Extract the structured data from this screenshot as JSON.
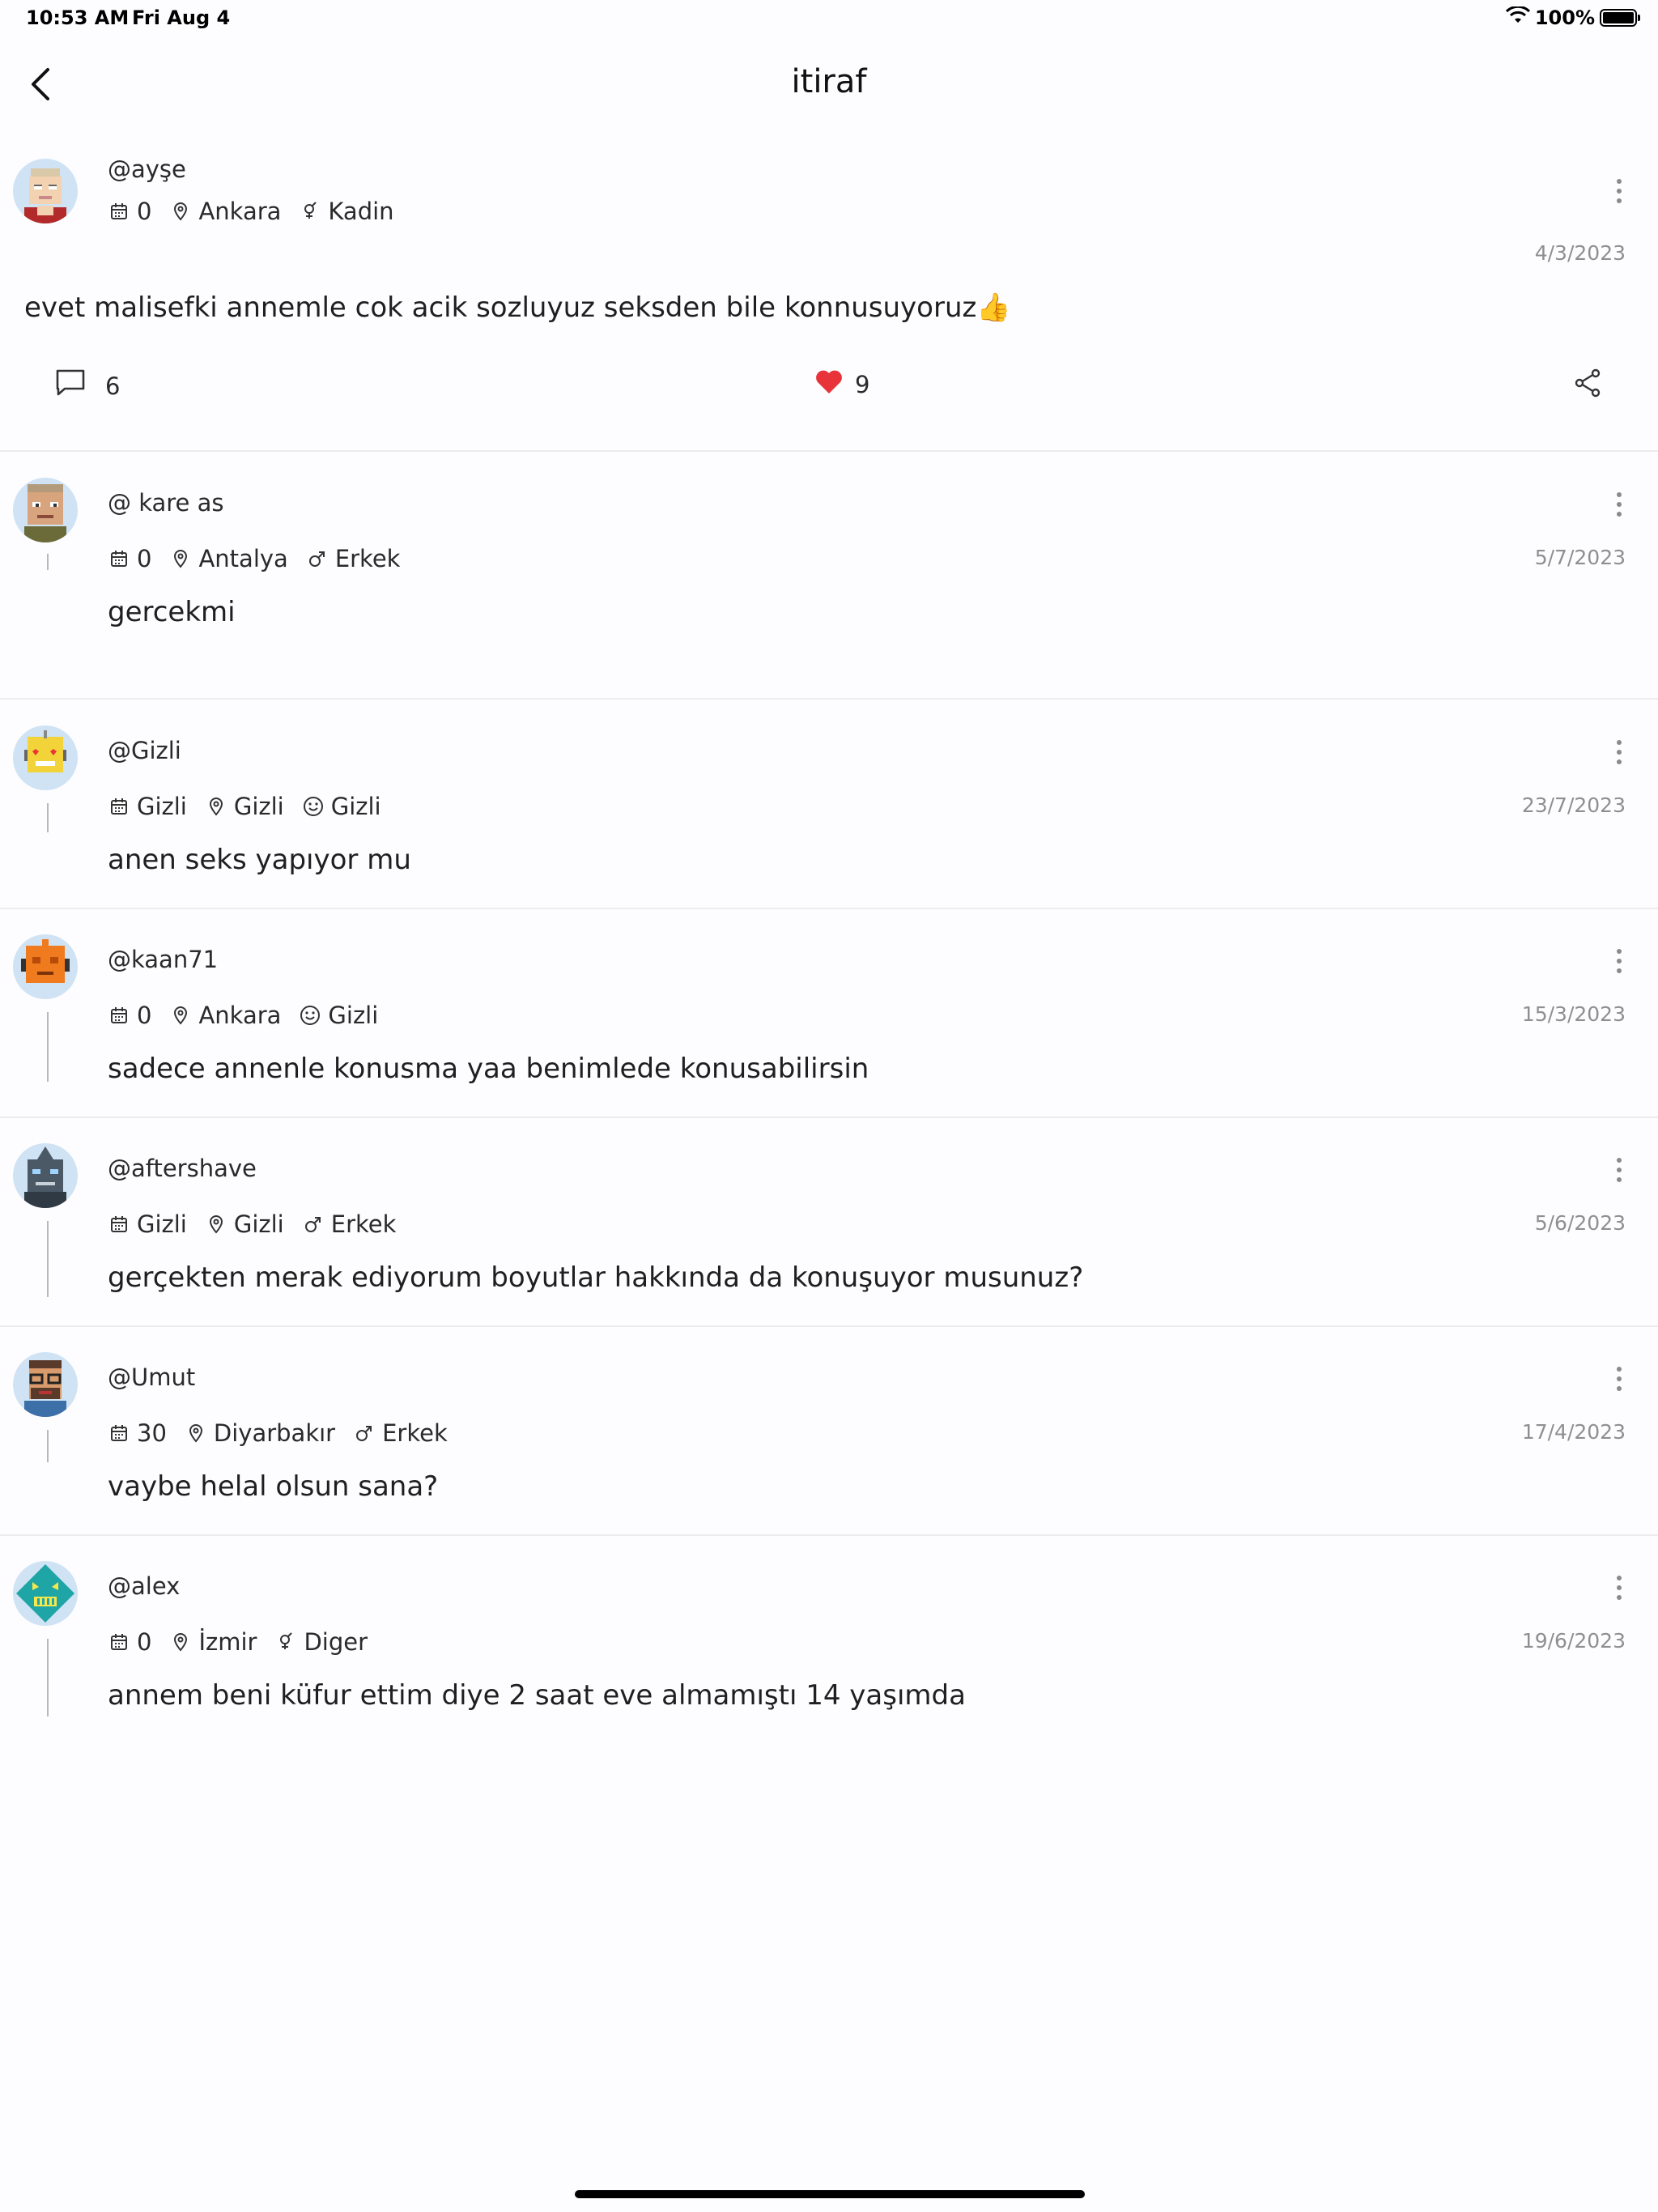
{
  "status_bar": {
    "time": "10:53 AM",
    "date": "Fri Aug 4",
    "battery_text": "100%"
  },
  "nav": {
    "title": "itiraf"
  },
  "post": {
    "username": "@ayşe",
    "age": "0",
    "city": "Ankara",
    "gender": "Kadin",
    "gender_icon": "intersex-icon",
    "date": "4/3/2023",
    "text": "evet malisefki annemle cok acik sozluyuz seksden bile konnusuyoruz👍",
    "comment_count": "6",
    "like_count": "9"
  },
  "comments": [
    {
      "username": "@ kare as",
      "age": "0",
      "city": "Antalya",
      "gender": "Erkek",
      "gender_icon": "male-icon",
      "date": "5/7/2023",
      "text": " gercekmi"
    },
    {
      "username": "@Gizli",
      "age": "Gizli",
      "city": "Gizli",
      "gender": "Gizli",
      "gender_icon": "smile-icon",
      "date": "23/7/2023",
      "text": "anen seks yapıyor mu"
    },
    {
      "username": "@kaan71",
      "age": "0",
      "city": "Ankara",
      "gender": "Gizli",
      "gender_icon": "smile-icon",
      "date": "15/3/2023",
      "text": "sadece annenle konusma yaa benimlede konusabilirsin"
    },
    {
      "username": "@aftershave",
      "age": "Gizli",
      "city": "Gizli",
      "gender": "Erkek",
      "gender_icon": "male-icon",
      "date": "5/6/2023",
      "text": "gerçekten merak ediyorum boyutlar hakkında da konuşuyor musunuz?"
    },
    {
      "username": "@Umut",
      "age": "30",
      "city": "Diyarbakır",
      "gender": "Erkek",
      "gender_icon": "male-icon",
      "date": "17/4/2023",
      "text": "vaybe helal olsun sana?"
    },
    {
      "username": "@alex",
      "age": "0",
      "city": "İzmir",
      "gender": "Diger",
      "gender_icon": "intersex-icon",
      "date": "19/6/2023",
      "text": "annem beni küfur ettim diye 2 saat eve almamıştı 14 yaşımda"
    }
  ],
  "colors": {
    "background": "#fdfcfe",
    "heart": "#e8333a",
    "divider": "#ececef",
    "date_text": "#8f8f8f"
  }
}
